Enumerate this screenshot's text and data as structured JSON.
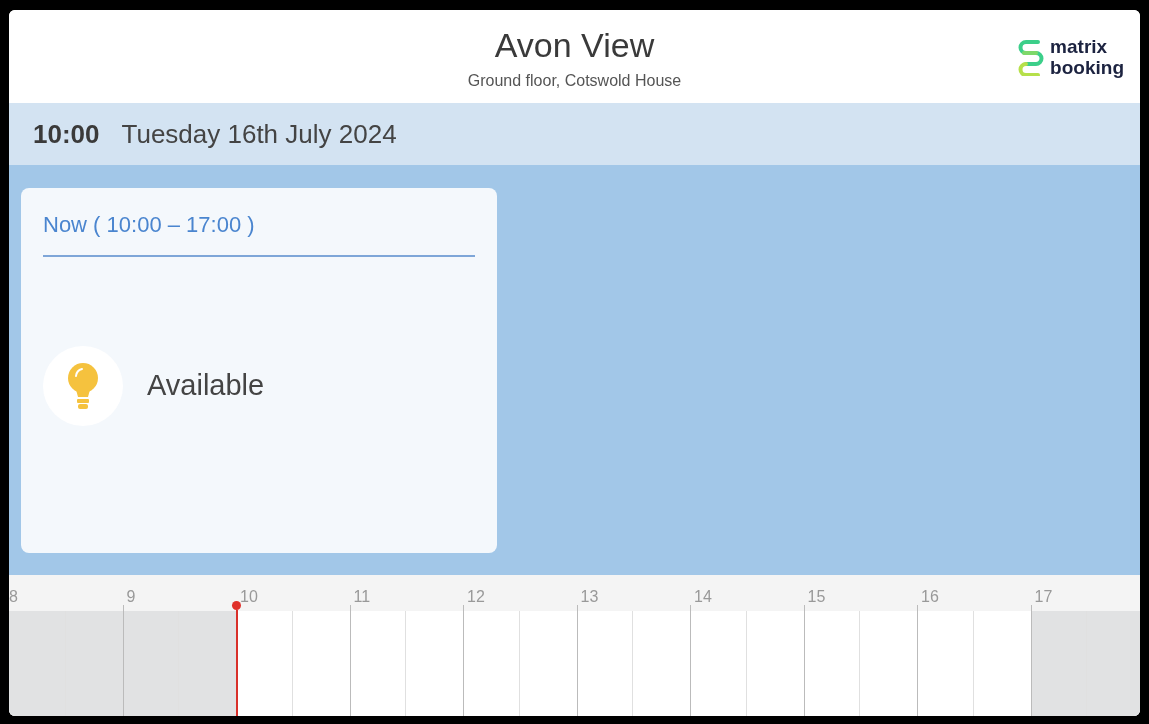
{
  "header": {
    "title": "Avon View",
    "subtitle": "Ground floor, Cotswold House",
    "logo_lines": [
      "matrix",
      "booking"
    ]
  },
  "date_bar": {
    "time": "10:00",
    "date": "Tuesday 16th July 2024"
  },
  "status_card": {
    "period": "Now ( 10:00 – 17:00 )",
    "status": "Available",
    "available": true
  },
  "timeline": {
    "hours": [
      {
        "label": "8",
        "shaded": true,
        "now": false
      },
      {
        "label": "9",
        "shaded": true,
        "now": false
      },
      {
        "label": "10",
        "shaded": false,
        "now": true
      },
      {
        "label": "11",
        "shaded": false,
        "now": false
      },
      {
        "label": "12",
        "shaded": false,
        "now": false
      },
      {
        "label": "13",
        "shaded": false,
        "now": false
      },
      {
        "label": "14",
        "shaded": false,
        "now": false
      },
      {
        "label": "15",
        "shaded": false,
        "now": false
      },
      {
        "label": "16",
        "shaded": false,
        "now": false
      },
      {
        "label": "17",
        "shaded": true,
        "now": false
      }
    ]
  }
}
